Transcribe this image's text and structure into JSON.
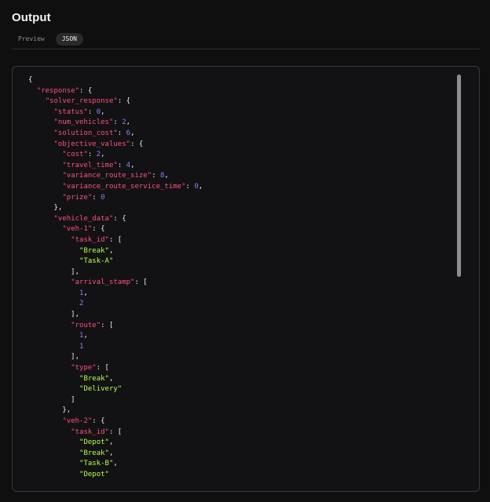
{
  "header": {
    "title": "Output",
    "tabs": [
      {
        "label": "Preview",
        "active": false
      },
      {
        "label": "JSON",
        "active": true
      }
    ]
  },
  "json_view": {
    "lines": [
      [
        {
          "t": "{",
          "c": "punc"
        }
      ],
      [
        {
          "t": "  ",
          "c": "punc"
        },
        {
          "t": "\"response\"",
          "c": "key"
        },
        {
          "t": ": {",
          "c": "punc"
        }
      ],
      [
        {
          "t": "    ",
          "c": "punc"
        },
        {
          "t": "\"solver_response\"",
          "c": "key"
        },
        {
          "t": ": {",
          "c": "punc"
        }
      ],
      [
        {
          "t": "      ",
          "c": "punc"
        },
        {
          "t": "\"status\"",
          "c": "key"
        },
        {
          "t": ": ",
          "c": "punc"
        },
        {
          "t": "0",
          "c": "num"
        },
        {
          "t": ",",
          "c": "punc"
        }
      ],
      [
        {
          "t": "      ",
          "c": "punc"
        },
        {
          "t": "\"num_vehicles\"",
          "c": "key"
        },
        {
          "t": ": ",
          "c": "punc"
        },
        {
          "t": "2",
          "c": "num"
        },
        {
          "t": ",",
          "c": "punc"
        }
      ],
      [
        {
          "t": "      ",
          "c": "punc"
        },
        {
          "t": "\"solution_cost\"",
          "c": "key"
        },
        {
          "t": ": ",
          "c": "punc"
        },
        {
          "t": "6",
          "c": "num"
        },
        {
          "t": ",",
          "c": "punc"
        }
      ],
      [
        {
          "t": "      ",
          "c": "punc"
        },
        {
          "t": "\"objective_values\"",
          "c": "key"
        },
        {
          "t": ": {",
          "c": "punc"
        }
      ],
      [
        {
          "t": "        ",
          "c": "punc"
        },
        {
          "t": "\"cost\"",
          "c": "key"
        },
        {
          "t": ": ",
          "c": "punc"
        },
        {
          "t": "2",
          "c": "num"
        },
        {
          "t": ",",
          "c": "punc"
        }
      ],
      [
        {
          "t": "        ",
          "c": "punc"
        },
        {
          "t": "\"travel_time\"",
          "c": "key"
        },
        {
          "t": ": ",
          "c": "punc"
        },
        {
          "t": "4",
          "c": "num"
        },
        {
          "t": ",",
          "c": "punc"
        }
      ],
      [
        {
          "t": "        ",
          "c": "punc"
        },
        {
          "t": "\"variance_route_size\"",
          "c": "key"
        },
        {
          "t": ": ",
          "c": "punc"
        },
        {
          "t": "8",
          "c": "num"
        },
        {
          "t": ",",
          "c": "punc"
        }
      ],
      [
        {
          "t": "        ",
          "c": "punc"
        },
        {
          "t": "\"variance_route_service_time\"",
          "c": "key"
        },
        {
          "t": ": ",
          "c": "punc"
        },
        {
          "t": "0",
          "c": "num"
        },
        {
          "t": ",",
          "c": "punc"
        }
      ],
      [
        {
          "t": "        ",
          "c": "punc"
        },
        {
          "t": "\"prize\"",
          "c": "key"
        },
        {
          "t": ": ",
          "c": "punc"
        },
        {
          "t": "0",
          "c": "num"
        }
      ],
      [
        {
          "t": "      },",
          "c": "punc"
        }
      ],
      [
        {
          "t": "      ",
          "c": "punc"
        },
        {
          "t": "\"vehicle_data\"",
          "c": "key"
        },
        {
          "t": ": {",
          "c": "punc"
        }
      ],
      [
        {
          "t": "        ",
          "c": "punc"
        },
        {
          "t": "\"veh-1\"",
          "c": "key"
        },
        {
          "t": ": {",
          "c": "punc"
        }
      ],
      [
        {
          "t": "          ",
          "c": "punc"
        },
        {
          "t": "\"task_id\"",
          "c": "key"
        },
        {
          "t": ": [",
          "c": "punc"
        }
      ],
      [
        {
          "t": "            ",
          "c": "punc"
        },
        {
          "t": "\"Break\"",
          "c": "str"
        },
        {
          "t": ",",
          "c": "punc"
        }
      ],
      [
        {
          "t": "            ",
          "c": "punc"
        },
        {
          "t": "\"Task-A\"",
          "c": "str"
        }
      ],
      [
        {
          "t": "          ],",
          "c": "punc"
        }
      ],
      [
        {
          "t": "          ",
          "c": "punc"
        },
        {
          "t": "\"arrival_stamp\"",
          "c": "key"
        },
        {
          "t": ": [",
          "c": "punc"
        }
      ],
      [
        {
          "t": "            ",
          "c": "punc"
        },
        {
          "t": "1",
          "c": "num"
        },
        {
          "t": ",",
          "c": "punc"
        }
      ],
      [
        {
          "t": "            ",
          "c": "punc"
        },
        {
          "t": "2",
          "c": "num"
        }
      ],
      [
        {
          "t": "          ],",
          "c": "punc"
        }
      ],
      [
        {
          "t": "          ",
          "c": "punc"
        },
        {
          "t": "\"route\"",
          "c": "key"
        },
        {
          "t": ": [",
          "c": "punc"
        }
      ],
      [
        {
          "t": "            ",
          "c": "punc"
        },
        {
          "t": "1",
          "c": "num"
        },
        {
          "t": ",",
          "c": "punc"
        }
      ],
      [
        {
          "t": "            ",
          "c": "punc"
        },
        {
          "t": "1",
          "c": "num"
        }
      ],
      [
        {
          "t": "          ],",
          "c": "punc"
        }
      ],
      [
        {
          "t": "          ",
          "c": "punc"
        },
        {
          "t": "\"type\"",
          "c": "key"
        },
        {
          "t": ": [",
          "c": "punc"
        }
      ],
      [
        {
          "t": "            ",
          "c": "punc"
        },
        {
          "t": "\"Break\"",
          "c": "str"
        },
        {
          "t": ",",
          "c": "punc"
        }
      ],
      [
        {
          "t": "            ",
          "c": "punc"
        },
        {
          "t": "\"Delivery\"",
          "c": "str"
        }
      ],
      [
        {
          "t": "          ]",
          "c": "punc"
        }
      ],
      [
        {
          "t": "        },",
          "c": "punc"
        }
      ],
      [
        {
          "t": "        ",
          "c": "punc"
        },
        {
          "t": "\"veh-2\"",
          "c": "key"
        },
        {
          "t": ": {",
          "c": "punc"
        }
      ],
      [
        {
          "t": "          ",
          "c": "punc"
        },
        {
          "t": "\"task_id\"",
          "c": "key"
        },
        {
          "t": ": [",
          "c": "punc"
        }
      ],
      [
        {
          "t": "            ",
          "c": "punc"
        },
        {
          "t": "\"Depot\"",
          "c": "str"
        },
        {
          "t": ",",
          "c": "punc"
        }
      ],
      [
        {
          "t": "            ",
          "c": "punc"
        },
        {
          "t": "\"Break\"",
          "c": "str"
        },
        {
          "t": ",",
          "c": "punc"
        }
      ],
      [
        {
          "t": "            ",
          "c": "punc"
        },
        {
          "t": "\"Task-B\"",
          "c": "str"
        },
        {
          "t": ",",
          "c": "punc"
        }
      ],
      [
        {
          "t": "            ",
          "c": "punc"
        },
        {
          "t": "\"Depot\"",
          "c": "str"
        }
      ]
    ]
  },
  "colors": {
    "background": "#0f0f10",
    "panel": "#121214",
    "border": "#3a3a3d",
    "key": "#ff4f7f",
    "string": "#b7ff4a",
    "number": "#8b7dff",
    "punctuation": "#f0f0f0",
    "active_tab": "#2a2a2c"
  }
}
